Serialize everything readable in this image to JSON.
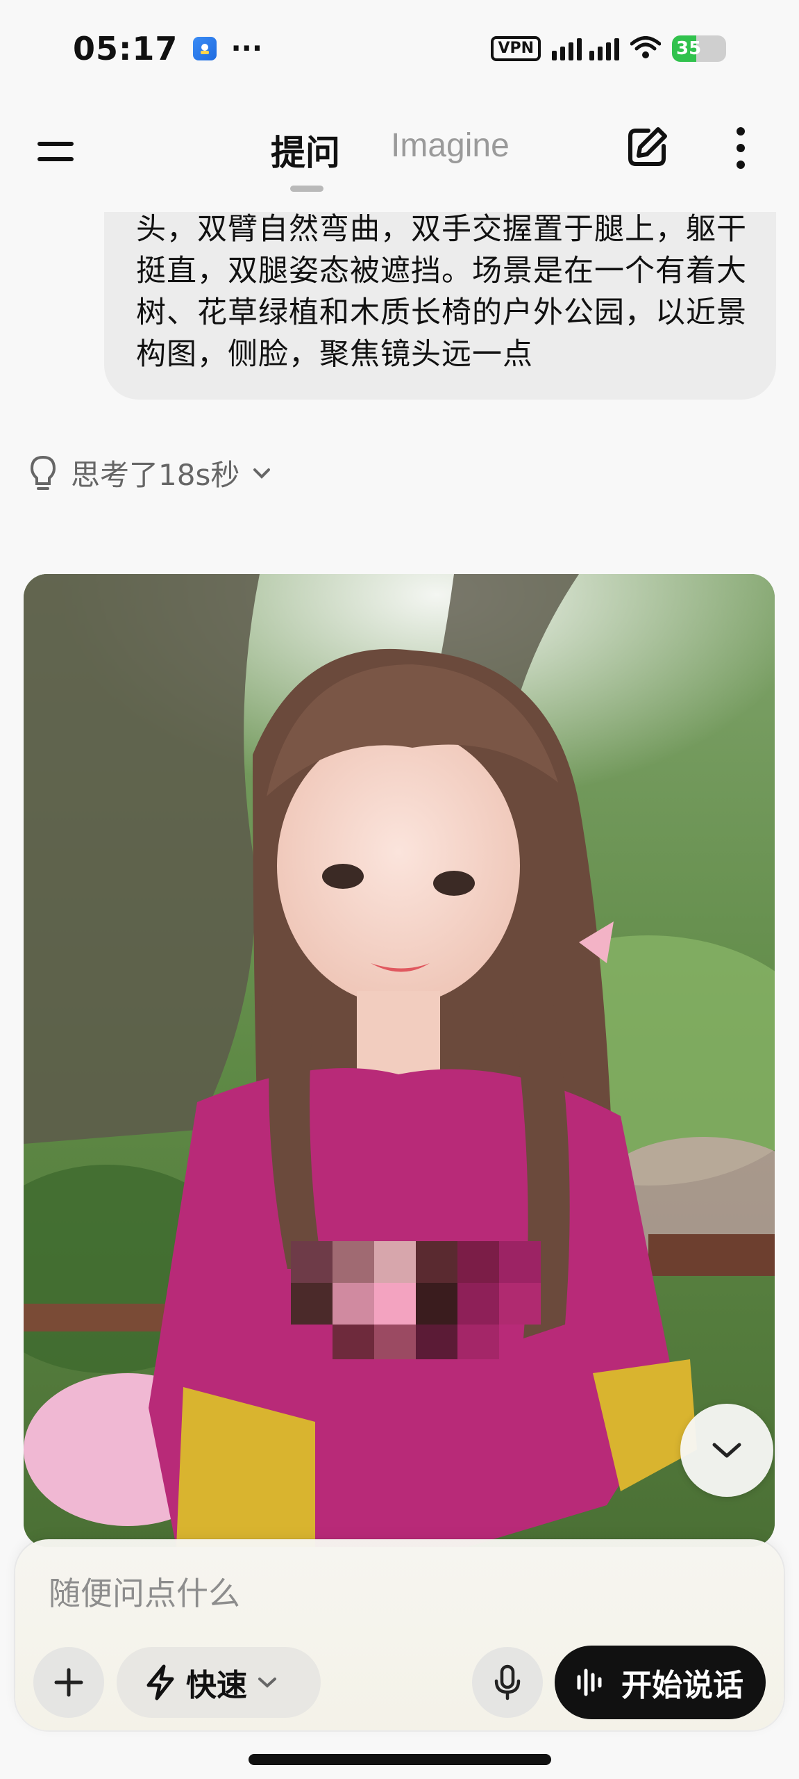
{
  "status_bar": {
    "time": "05:17",
    "dots": "···",
    "vpn": "VPN",
    "battery": "35"
  },
  "header": {
    "tab_active": "提问",
    "tab_other": "Imagine",
    "menu_icon": "hamburger-icon",
    "edit_icon": "edit-icon",
    "more_icon": "more-vertical-icon"
  },
  "conversation": {
    "user_message_visible": "头，双臂自然弯曲，双手交握置于腿上，躯干挺直，双腿姿态被遮挡。场景是在一个有着大树、花草绿植和木质长椅的户外公园，以近景构图，侧脸，聚焦镜头远一点",
    "thinking_label": "思考了18s秒",
    "thinking_icon": "lightbulb-icon"
  },
  "composer": {
    "placeholder": "随便问点什么",
    "mode_label": "快速",
    "voice_label": "开始说话"
  },
  "colors": {
    "battery_green": "#31c24d",
    "voice_button_bg": "#111111",
    "sweater_magenta": "#b82a78",
    "sleeve_yellow": "#d9b42f"
  }
}
